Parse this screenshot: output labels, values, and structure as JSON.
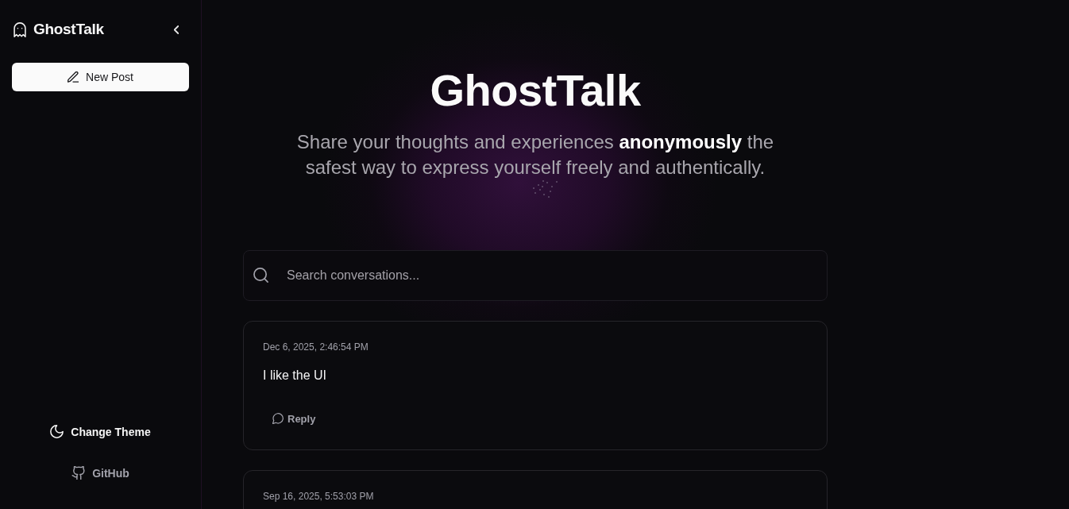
{
  "sidebar": {
    "brand": "GhostTalk",
    "new_post_button": "New Post",
    "footer_links": [
      {
        "kind": "theme",
        "label": "Change Theme"
      },
      {
        "kind": "github",
        "label": "GitHub"
      }
    ]
  },
  "hero": {
    "title": "GhostTalk",
    "subtitle": "Share your thoughts and experiences **anonymously** the safest way to express yourself freely and authentically."
  },
  "search": {
    "placeholder": "Search conversations..."
  },
  "posts": [
    {
      "date": "Dec 6, 2025, 2:46:54 PM",
      "text": "I like the UI",
      "reply_label": "Reply"
    },
    {
      "date": "Sep 16, 2025, 5:53:03 PM"
    }
  ]
}
